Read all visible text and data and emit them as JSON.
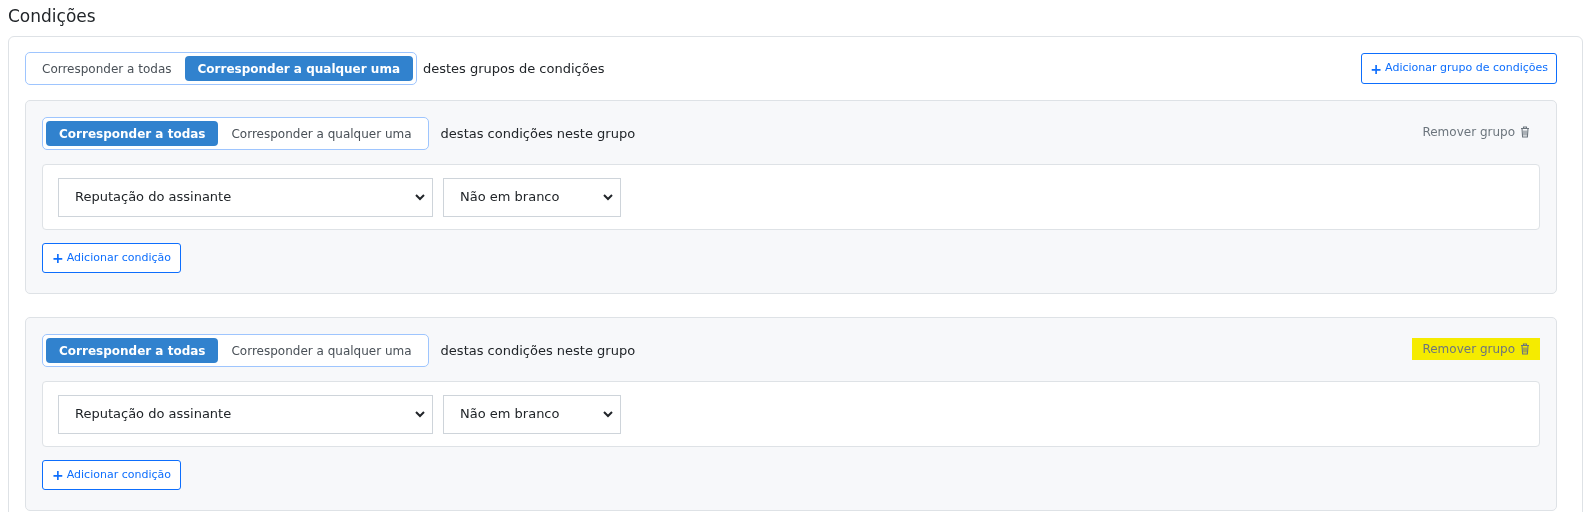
{
  "title": "Condições",
  "match_toggle": [
    {
      "label": "Corresponder a todas",
      "selected": false
    },
    {
      "label": "Corresponder a qualquer uma",
      "selected": true
    }
  ],
  "match_suffix": "destes grupos de condições",
  "add_group_button": {
    "icon": "+",
    "label": "Adicionar grupo de condições"
  },
  "groups": [
    {
      "match_toggle": [
        {
          "label": "Corresponder a todas",
          "selected": true
        },
        {
          "label": "Corresponder a qualquer uma",
          "selected": false
        }
      ],
      "match_suffix": "destas condições neste grupo",
      "remove": {
        "label": "Remover grupo",
        "highlighted": false
      },
      "conditions": [
        {
          "field": "Reputação do assinante",
          "operator": "Não em branco"
        }
      ],
      "add_condition": {
        "icon": "+",
        "label": "Adicionar condição"
      }
    },
    {
      "match_toggle": [
        {
          "label": "Corresponder a todas",
          "selected": true
        },
        {
          "label": "Corresponder a qualquer uma",
          "selected": false
        }
      ],
      "match_suffix": "destas condições neste grupo",
      "remove": {
        "label": "Remover grupo",
        "highlighted": true
      },
      "conditions": [
        {
          "field": "Reputação do assinante",
          "operator": "Não em branco"
        }
      ],
      "add_condition": {
        "icon": "+",
        "label": "Adicionar condição"
      }
    }
  ]
}
